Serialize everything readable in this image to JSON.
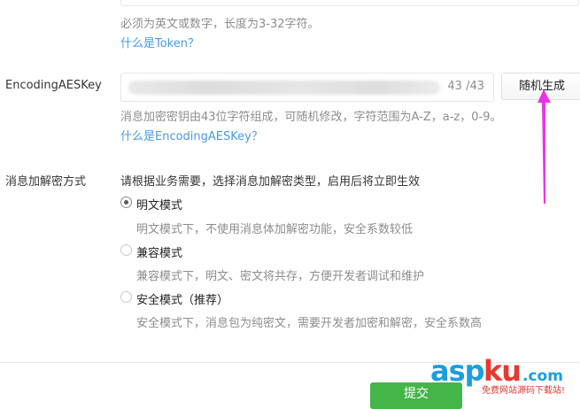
{
  "token": {
    "hint": "必须为英文或数字，长度为3-32字符。",
    "help_link": "什么是Token？"
  },
  "aeskey": {
    "label": "EncodingAESKey",
    "char_count": "43 /43",
    "random_button": "随机生成",
    "hint": "消息加密密钥由43位字符组成，可随机修改，字符范围为A-Z，a-z，0-9。",
    "help_link": "什么是EncodingAESKey？"
  },
  "encryption": {
    "label": "消息加解密方式",
    "instruction": "请根据业务需要，选择消息加解密类型，启用后将立即生效",
    "options": [
      {
        "label": "明文模式",
        "desc": "明文模式下，不使用消息体加解密功能，安全系数较低",
        "checked": true
      },
      {
        "label": "兼容模式",
        "desc": "兼容模式下，明文、密文将共存，方便开发者调试和维护",
        "checked": false
      },
      {
        "label": "安全模式（推荐）",
        "desc": "安全模式下，消息包为纯密文，需要开发者加密和解密，安全系数高",
        "checked": false
      }
    ]
  },
  "footer": {
    "save_button": "提交"
  },
  "watermark": {
    "logo": "aspku.com",
    "tagline": "免费网站源码下载站!"
  },
  "colors": {
    "link": "#459ae9",
    "arrow": "#e935e5",
    "save": "#44b549"
  }
}
